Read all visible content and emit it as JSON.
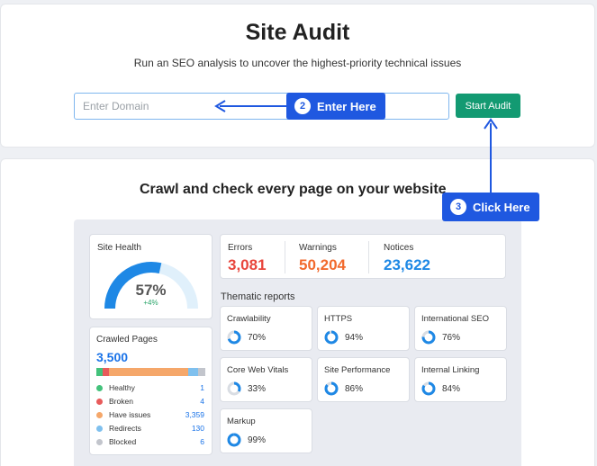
{
  "header": {
    "title": "Site Audit",
    "subtitle": "Run an SEO analysis to uncover the highest-priority technical issues",
    "domain_placeholder": "Enter Domain",
    "start_button": "Start Audit"
  },
  "callouts": [
    {
      "num": "2",
      "label": "Enter Here"
    },
    {
      "num": "3",
      "label": "Click Here"
    }
  ],
  "preview": {
    "title": "Crawl and check every page on your website",
    "site_health": {
      "label": "Site Health",
      "value": "57%",
      "change": "+4%",
      "fraction": 0.57
    },
    "crawled": {
      "label": "Crawled Pages",
      "value": "3,500",
      "legend": [
        {
          "label": "Healthy",
          "count": "1",
          "color": "#43c27b"
        },
        {
          "label": "Broken",
          "count": "4",
          "color": "#e85b5b"
        },
        {
          "label": "Have issues",
          "count": "3,359",
          "color": "#f5a76a"
        },
        {
          "label": "Redirects",
          "count": "130",
          "color": "#7fc0ee"
        },
        {
          "label": "Blocked",
          "count": "6",
          "color": "#c2c5cc"
        }
      ]
    },
    "stats": [
      {
        "label": "Errors",
        "value": "3,081",
        "color": "#e8453c"
      },
      {
        "label": "Warnings",
        "value": "50,204",
        "color": "#f26a2d"
      },
      {
        "label": "Notices",
        "value": "23,622",
        "color": "#1e88e5"
      }
    ],
    "thematic_label": "Thematic reports",
    "reports": [
      {
        "name": "Crawlability",
        "pct": "70%",
        "value": 70
      },
      {
        "name": "HTTPS",
        "pct": "94%",
        "value": 94
      },
      {
        "name": "International SEO",
        "pct": "76%",
        "value": 76
      },
      {
        "name": "Core Web Vitals",
        "pct": "33%",
        "value": 33
      },
      {
        "name": "Site Performance",
        "pct": "86%",
        "value": 86
      },
      {
        "name": "Internal Linking",
        "pct": "84%",
        "value": 84
      },
      {
        "name": "Markup",
        "pct": "99%",
        "value": 99
      }
    ]
  }
}
